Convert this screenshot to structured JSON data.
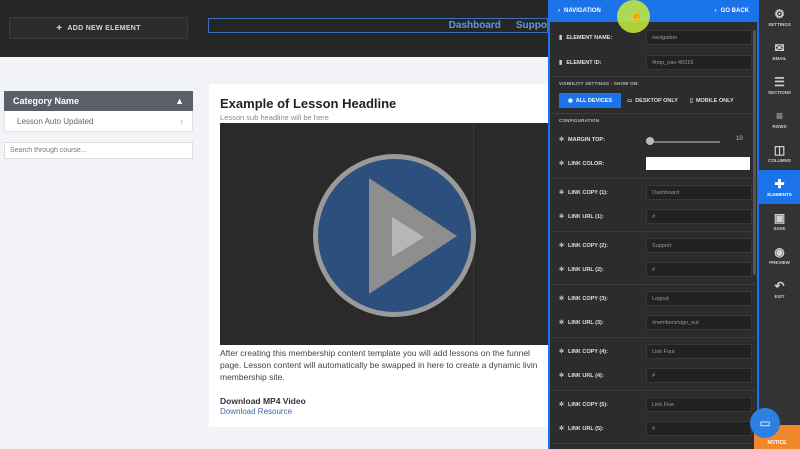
{
  "editor": {
    "add_element_label": "ADD NEW ELEMENT",
    "nav_links": [
      "Dashboard",
      "Suppo"
    ]
  },
  "sidebar": {
    "category_name": "Category Name",
    "lesson_item": "Lesson Auto Updated",
    "search_placeholder": "Search through course..."
  },
  "lesson": {
    "title": "Example of Lesson Headline",
    "subtitle": "Lesson sub headline will be here",
    "body": "After creating this membership content template you will add lessons on the funnel page. Lesson content will automatically be swapped in here to create a dynamic livin membership site.",
    "download_title": "Download MP4 Video",
    "download_link": "Download Resource"
  },
  "panel": {
    "title": "NAVIGATION",
    "go_back": "GO BACK",
    "element_name_label": "ELEMENT NAME:",
    "element_name_value": "navigation",
    "element_id_label": "ELEMENT ID:",
    "element_id_value": "#tmp_nav-40316",
    "visibility_label": "VISIBILITY SETTINGS - SHOW ON:",
    "visibility_options": [
      "ALL DEVICES",
      "DESKTOP ONLY",
      "MOBILE ONLY"
    ],
    "configuration_label": "CONFIGURATION",
    "margin_top_label": "MARGIN TOP:",
    "margin_top_value": "10",
    "margin_top_fraction": 0.0,
    "link_color_label": "LINK COLOR:",
    "link_color": "#ffffff",
    "links": [
      {
        "copy_label": "LINK COPY (1):",
        "copy_value": "Dashboard",
        "url_label": "LINK URL (1):",
        "url_value": "#"
      },
      {
        "copy_label": "LINK COPY (2):",
        "copy_value": "Support",
        "url_label": "LINK URL (2):",
        "url_value": "#"
      },
      {
        "copy_label": "LINK COPY (3):",
        "copy_value": "Logout",
        "url_label": "LINK URL (3):",
        "url_value": "/members/sign_out"
      },
      {
        "copy_label": "LINK COPY (4):",
        "copy_value": "Link Four",
        "url_label": "LINK URL (4):",
        "url_value": "#"
      },
      {
        "copy_label": "LINK COPY (5):",
        "copy_value": "Link Five",
        "url_label": "LINK URL (5):",
        "url_value": "#"
      }
    ]
  },
  "rail": {
    "items": [
      "SETTINGS",
      "EMAIL",
      "SECTIONS",
      "ROWS",
      "COLUMNS",
      "ELEMENTS",
      "SAVE",
      "PREVIEW",
      "EXIT"
    ],
    "active": "ELEMENTS",
    "notice": "NOTICE"
  },
  "colors": {
    "accent": "#1a73e8",
    "notice": "#f0872b"
  }
}
